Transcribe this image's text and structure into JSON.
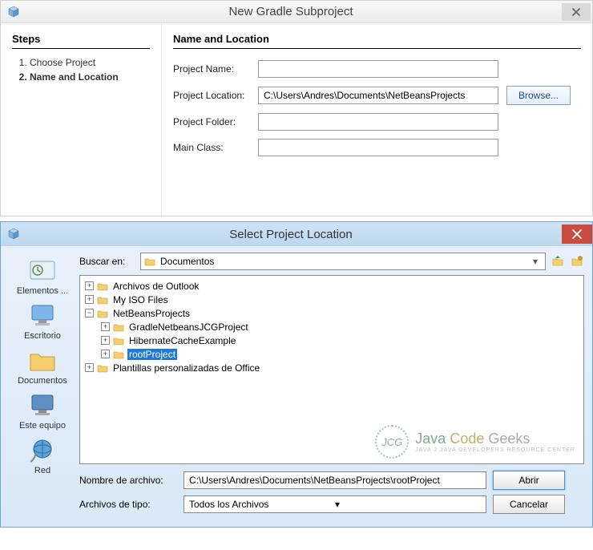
{
  "dialog1": {
    "title": "New Gradle Subproject",
    "steps_heading": "Steps",
    "steps": {
      "s1": "Choose Project",
      "s2": "Name and Location"
    },
    "form_heading": "Name and Location",
    "labels": {
      "project_name": "Project Name:",
      "project_location": "Project Location:",
      "project_folder": "Project Folder:",
      "main_class": "Main Class:"
    },
    "values": {
      "project_name": "",
      "project_location": "C:\\Users\\Andres\\Documents\\NetBeansProjects",
      "project_folder": "",
      "main_class": ""
    },
    "browse_label": "Browse..."
  },
  "dialog2": {
    "title": "Select Project Location",
    "lookin_label": "Buscar en:",
    "lookin_value": "Documentos",
    "places": {
      "recent": "Elementos ...",
      "desktop": "Escritorio",
      "documents": "Documentos",
      "computer": "Este equipo",
      "network": "Red"
    },
    "tree": {
      "n1": "Archivos de Outlook",
      "n2": "My ISO Files",
      "n3": "NetBeansProjects",
      "n3a": "GradleNetbeansJCGProject",
      "n3b": "HibernateCacheExample",
      "n3c": "rootProject",
      "n4": "Plantillas personalizadas de Office"
    },
    "filename_label": "Nombre de archivo:",
    "filename_value": "C:\\Users\\Andres\\Documents\\NetBeansProjects\\rootProject",
    "filetype_label": "Archivos de tipo:",
    "filetype_value": "Todos los Archivos",
    "open_label": "Abrir",
    "cancel_label": "Cancelar",
    "watermark": {
      "brand": "Java Code Geeks",
      "tagline": "Java 2 Java Developers Resource Center"
    }
  }
}
